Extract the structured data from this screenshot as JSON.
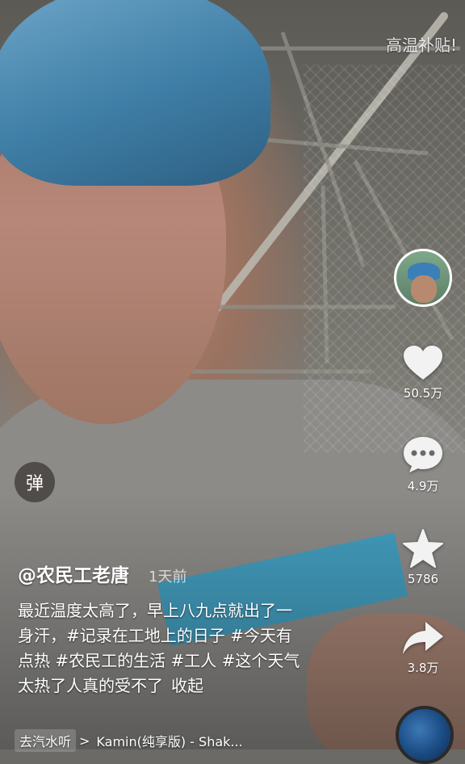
{
  "watermark": "高温补贴!",
  "side_actions": {
    "likes": "50.5万",
    "comments": "4.9万",
    "favorites": "5786",
    "shares": "3.8万"
  },
  "danmu_label": "弹",
  "post": {
    "author": "@农民工老唐",
    "time": "1天前",
    "caption_lines": [
      "最近温度太高了，早上八九点就出了一",
      "身汗，#记录在工地上的日子 #今天有",
      "点热 #农民工的生活 #工人 #这个天气",
      "太热了人真的受不了"
    ],
    "collapse_label": "收起"
  },
  "music": {
    "tag": "去汽水听",
    "arrow": ">",
    "title": "Kamin(纯享版) - Shak..."
  }
}
